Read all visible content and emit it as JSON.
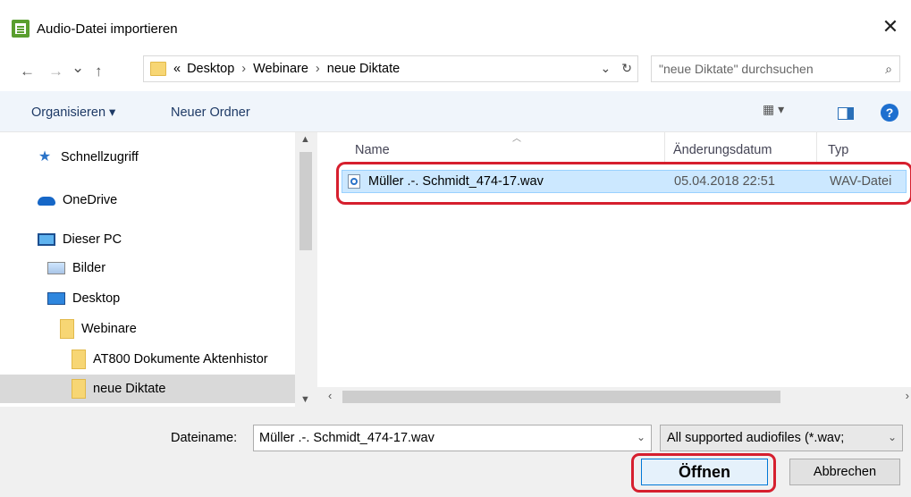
{
  "window": {
    "title": "Audio-Datei importieren",
    "close": "✕"
  },
  "nav": {
    "back": "←",
    "forward": "→",
    "recent": "⌄",
    "up": "↑",
    "path_prefix": "«",
    "breadcrumbs": [
      "Desktop",
      "Webinare",
      "neue Diktate"
    ],
    "sep": "›",
    "dropdown": "⌄",
    "refresh": "↻",
    "search_placeholder": "\"neue Diktate\" durchsuchen"
  },
  "toolbar": {
    "organize": "Organisieren ▾",
    "new_folder": "Neuer Ordner",
    "view": "▦ ▾",
    "help": "?"
  },
  "sidebar": {
    "items": [
      {
        "label": "Schnellzugriff",
        "icon": "star-icon"
      },
      {
        "label": "OneDrive",
        "icon": "cloud-icon"
      },
      {
        "label": "Dieser PC",
        "icon": "pc-icon"
      },
      {
        "label": "Bilder",
        "icon": "pictures-icon"
      },
      {
        "label": "Desktop",
        "icon": "desktop-icon"
      },
      {
        "label": "Webinare",
        "icon": "folder-icon"
      },
      {
        "label": "AT800 Dokumente Aktenhistor",
        "icon": "folder-icon"
      },
      {
        "label": "neue Diktate",
        "icon": "folder-icon",
        "selected": true
      }
    ]
  },
  "filelist": {
    "columns": {
      "name": "Name",
      "date": "Änderungsdatum",
      "type": "Typ"
    },
    "files": [
      {
        "name": "Müller .-. Schmidt_474-17.wav",
        "date": "05.04.2018 22:51",
        "type": "WAV-Datei",
        "selected": true
      }
    ]
  },
  "bottom": {
    "filename_label": "Dateiname:",
    "filename_value": "Müller .-. Schmidt_474-17.wav",
    "filetype": "All supported audiofiles (*.wav;",
    "open": "Öffnen",
    "cancel": "Abbrechen"
  },
  "colors": {
    "highlight": "#d61f2e",
    "selection": "#cce8ff",
    "accent": "#0078d7"
  }
}
